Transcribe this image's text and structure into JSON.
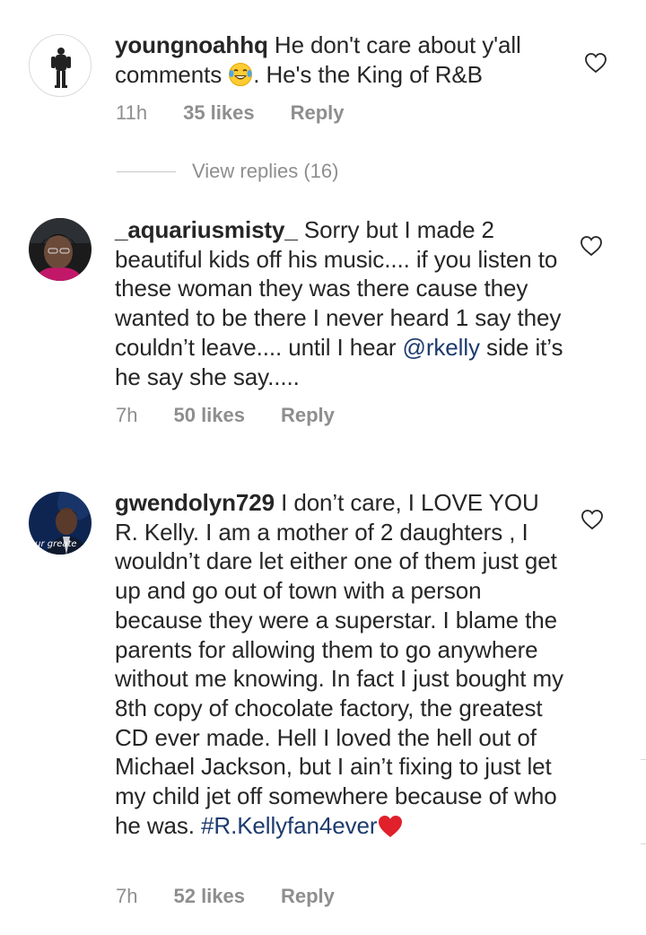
{
  "comments": [
    {
      "username": "youngnoahhq",
      "text_before_emoji": "He don't care about y'all comments ",
      "emoji": "tears-of-joy-emoji",
      "text_after_emoji": ". He's the King of R&B",
      "time": "11h",
      "likes": "35 likes",
      "reply": "Reply"
    },
    {
      "username": "_aquariusmisty_",
      "text_before_mention": "Sorry but I made 2 beautiful kids off his music.... if you listen to these woman they was there cause they wanted to be there I never heard 1 say they couldn’t leave.... until I hear ",
      "mention": "@rkelly",
      "text_after_mention": " side it’s he say she say.....",
      "time": "7h",
      "likes": "50 likes",
      "reply": "Reply"
    },
    {
      "username": "gwendolyn729",
      "text": "I don’t care, I LOVE YOU R. Kelly. I am a mother of 2 daughters , I wouldn’t dare let either one of them just get up and go out of town with a person because they were a superstar. I blame the parents for allowing them to go anywhere without me knowing. In fact I just bought my 8th copy of chocolate factory, the greatest CD ever made. Hell I loved the hell out of Michael Jackson, but I ain’t fixing to just let my child jet off somewhere because of who he was. ",
      "hashtag": "#R.Kellyfan4ever",
      "emoji": "red-heart-emoji",
      "avatar_caption": "our greate",
      "time": "7h",
      "likes": "52 likes",
      "reply": "Reply"
    }
  ],
  "view_replies": "View replies (16)",
  "colors": {
    "text": "#262626",
    "meta": "#8e8e8e",
    "link": "#1d3b6e",
    "heart_red": "#e0202a"
  }
}
